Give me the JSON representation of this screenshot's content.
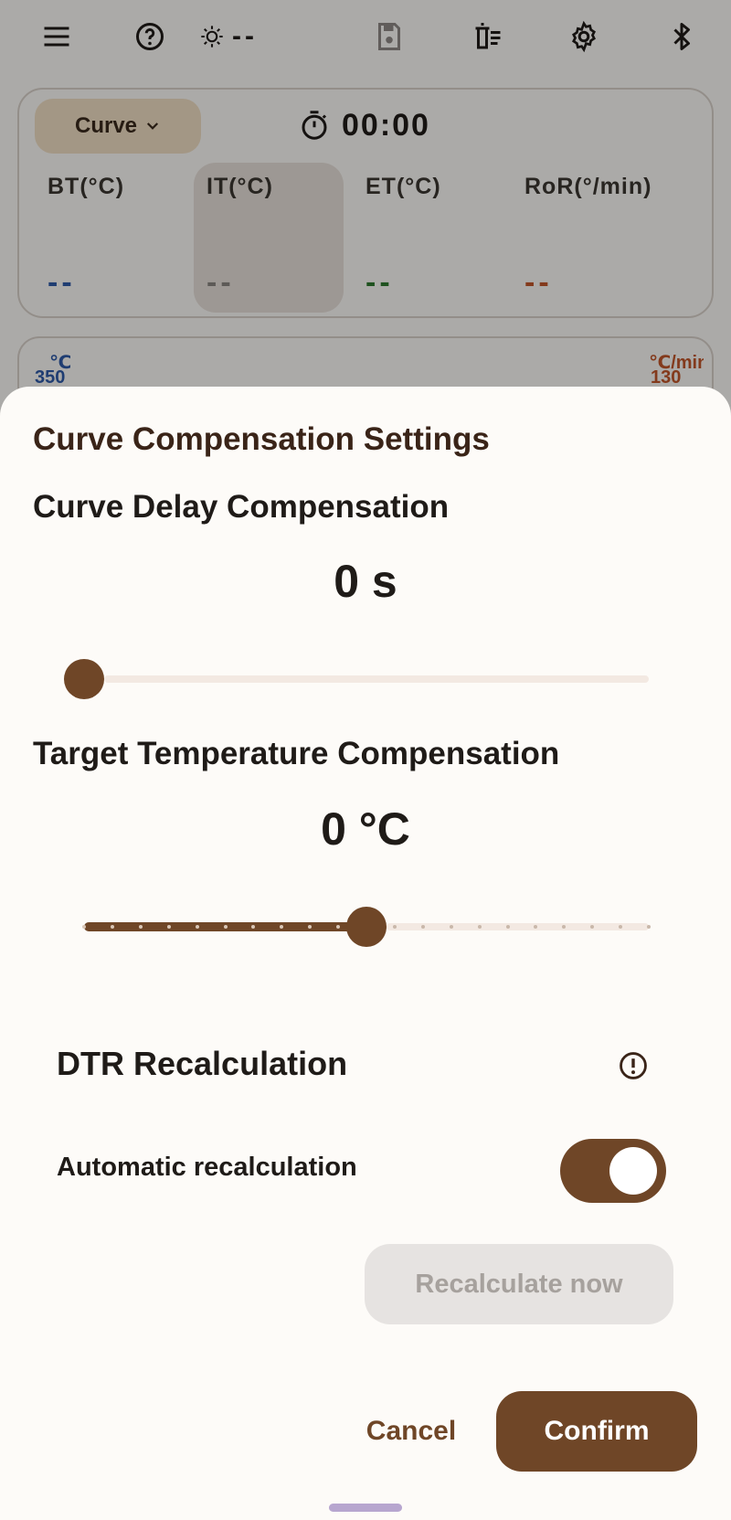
{
  "topbar": {
    "icons": [
      "menu-icon",
      "help-icon",
      "brightness-icon",
      "save-icon",
      "delete-list-icon",
      "gear-icon",
      "bluetooth-icon"
    ],
    "brightness_value": "--"
  },
  "readout": {
    "curve_chip_label": "Curve",
    "timer": "00:00",
    "metrics": [
      {
        "label": "BT(°C)",
        "value": "--",
        "color": "#2f5aa8"
      },
      {
        "label": "IT(°C)",
        "value": "--",
        "color": "#8a8580"
      },
      {
        "label": "ET(°C)",
        "value": "--",
        "color": "#2f7a2f"
      },
      {
        "label": "RoR(°/min)",
        "value": "--",
        "color": "#c2562a"
      }
    ]
  },
  "chart": {
    "left_unit": "℃",
    "left_top": "350",
    "right_unit": "℃/min",
    "right_top": "130"
  },
  "sheet": {
    "title": "Curve Compensation Settings",
    "delay": {
      "title": "Curve Delay Compensation",
      "value_text": "0 s",
      "slider_fraction": 0.0
    },
    "target": {
      "title": "Target Temperature Compensation",
      "value_text": "0 °C",
      "slider_fraction": 0.5,
      "steps": 20
    },
    "dtr": {
      "title": "DTR Recalculation",
      "auto_label": "Automatic recalculation",
      "auto_enabled": true,
      "recalc_label": "Recalculate now"
    },
    "cancel_label": "Cancel",
    "confirm_label": "Confirm"
  },
  "colors": {
    "accent": "#6f4627",
    "track_inactive": "#f3e9e2",
    "disabled_bg": "#e6e3e1",
    "disabled_text": "#a6a19d"
  }
}
